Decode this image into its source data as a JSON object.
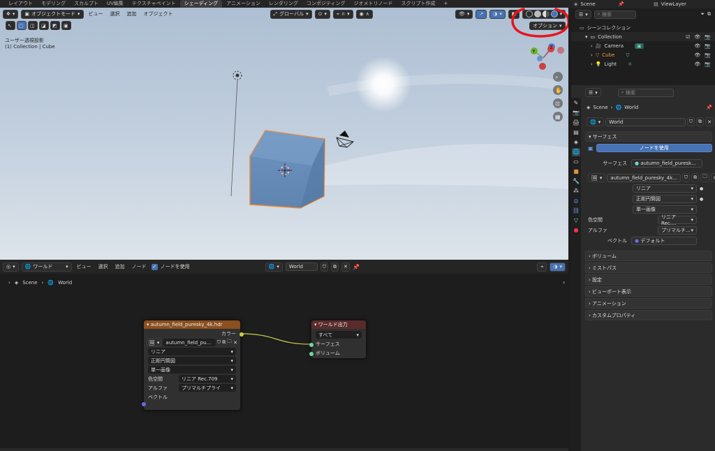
{
  "tabs": [
    "レイアウト",
    "モデリング",
    "スカルプト",
    "UV編集",
    "テクスチャペイント",
    "シェーディング",
    "アニメーション",
    "レンダリング",
    "コンポジティング",
    "ジオメトリノード",
    "スクリプト作成",
    "+"
  ],
  "active_tab_index": 5,
  "top_right": {
    "scene": "Scene",
    "view_layer": "ViewLayer"
  },
  "viewport": {
    "mode": "オブジェクトモード",
    "menus": [
      "ビュー",
      "選択",
      "追加",
      "オブジェクト"
    ],
    "orientation": "グローバル",
    "overlay_line1": "ユーザー透視投影",
    "overlay_line2": "(1) Collection | Cube",
    "options_label": "オプション",
    "gizmo_y": "Y",
    "gizmo_z": "Z"
  },
  "outliner": {
    "search_placeholder": "検索",
    "scene_collection": "シーンコレクション",
    "items": [
      "Collection",
      "Camera",
      "Cube",
      "Light"
    ]
  },
  "properties": {
    "search_placeholder": "検索",
    "breadcrumb": [
      "Scene",
      "World"
    ],
    "world_name": "World",
    "surface_panel": "サーフェス",
    "use_nodes_button": "ノードを使用",
    "surface_label": "サーフェス",
    "surface_value": "autumn_field_puresk...",
    "image_name": "autumn_field_puresky_4k...",
    "interpolation": "リニア",
    "projection": "正距円筒図",
    "source": "単一画像",
    "color_space_label": "色空間",
    "color_space": "リニア Rec....",
    "alpha_label": "アルファ",
    "alpha": "プリマルチ...",
    "vector_label": "ベクトル",
    "vector_value": "デフォルト",
    "collapsed_panels": [
      "ボリューム",
      "ミストパス",
      "設定",
      "ビューポート表示",
      "アニメーション",
      "カスタムプロパティ"
    ]
  },
  "node_editor": {
    "type": "ワールド",
    "menus": [
      "ビュー",
      "選択",
      "追加",
      "ノード"
    ],
    "use_nodes_label": "ノードを使用",
    "world_name": "World",
    "breadcrumb": [
      "Scene",
      "World"
    ],
    "env_node": {
      "title": "autumn_field_puresky_4k.hdr",
      "output_color": "カラー",
      "image": "autumn_field_pu...",
      "interpolation": "リニア",
      "projection": "正距円筒図",
      "source": "単一画像",
      "color_space_label": "色空間",
      "color_space": "リニア Rec.709",
      "alpha_label": "アルファ",
      "alpha": "プリマルチプライ",
      "vector_label": "ベクトル"
    },
    "output_node": {
      "title": "ワールド出力",
      "target": "すべて",
      "surface": "サーフェス",
      "volume": "ボリューム"
    }
  },
  "colors": {
    "accent_blue": "#4772b3",
    "env_node_header": "#8c4f1f",
    "output_node_header": "#5a2b2b",
    "annotation_red": "#e8141c",
    "selection_orange": "#f0882e"
  }
}
